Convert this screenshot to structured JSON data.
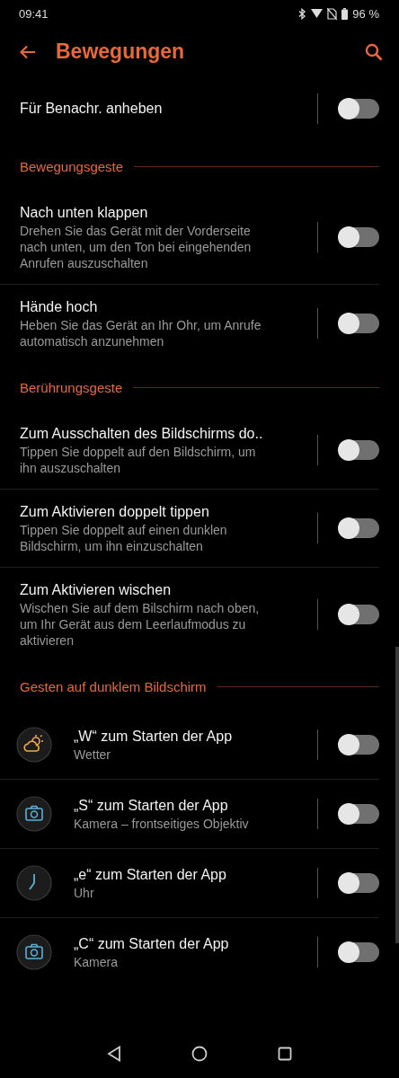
{
  "status_bar": {
    "time": "09:41",
    "battery": "96 %"
  },
  "header": {
    "title": "Bewegungen"
  },
  "sections": [
    {
      "items": [
        {
          "title": "Für Benachr. anheben",
          "on": false
        }
      ]
    },
    {
      "title": "Bewegungsgeste",
      "items": [
        {
          "title": "Nach unten klappen",
          "description": "Drehen Sie das Gerät mit der Vorderseite nach unten, um den Ton bei eingehenden Anrufen auszuschalten",
          "on": false
        },
        {
          "title": "Hände hoch",
          "description": "Heben Sie das Gerät an Ihr Ohr, um Anrufe automatisch anzunehmen",
          "on": false
        }
      ]
    },
    {
      "title": "Berührungsgeste",
      "items": [
        {
          "title": "Zum Ausschalten des Bildschirms do..",
          "description": "Tippen Sie doppelt auf den Bildschirm, um ihn auszuschalten",
          "on": false
        },
        {
          "title": "Zum Aktivieren doppelt tippen",
          "description": "Tippen Sie doppelt auf einen dunklen Bildschirm, um ihn einzuschalten",
          "on": false
        },
        {
          "title": "Zum Aktivieren wischen",
          "description": "Wischen Sie auf dem Bilschirm nach oben, um Ihr Gerät aus dem Leerlaufmodus zu aktivieren",
          "on": false
        }
      ]
    },
    {
      "title": "Gesten auf dunklem Bildschirm",
      "items": [
        {
          "kind": "weather",
          "title": "„W“ zum Starten der App",
          "description": "Wetter",
          "on": false
        },
        {
          "kind": "camera",
          "title": "„S“ zum Starten der App",
          "description": "Kamera – frontseitiges Objektiv",
          "on": false
        },
        {
          "kind": "clock",
          "title": "„e“ zum Starten der App",
          "description": "Uhr",
          "on": false
        },
        {
          "kind": "camera",
          "title": "„C“ zum Starten der App",
          "description": "Kamera",
          "on": false
        }
      ]
    }
  ]
}
